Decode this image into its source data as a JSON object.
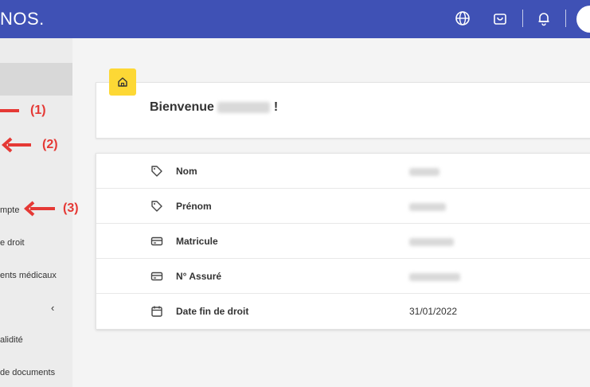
{
  "header": {
    "brand": "NOS.",
    "icons": [
      "globe-icon",
      "shopping-bag-icon",
      "bell-icon"
    ]
  },
  "sidebar": {
    "items": [
      {
        "label": "mpte"
      },
      {
        "label": "e droit"
      },
      {
        "label": "ents médicaux"
      },
      {
        "label": "alidité"
      },
      {
        "label": "de documents"
      }
    ],
    "chevron": "‹"
  },
  "annotations": [
    "(1)",
    "(2)",
    "(3)"
  ],
  "welcome": {
    "prefix": "Bienvenue",
    "suffix": "!"
  },
  "details": [
    {
      "icon": "tag-icon",
      "label": "Nom",
      "value": ""
    },
    {
      "icon": "tag-icon",
      "label": "Prénom",
      "value": ""
    },
    {
      "icon": "id-card-icon",
      "label": "Matricule",
      "value": ""
    },
    {
      "icon": "id-card-icon",
      "label": "N° Assuré",
      "value": ""
    },
    {
      "icon": "calendar-icon",
      "label": "Date fin de droit",
      "value": "31/01/2022"
    }
  ],
  "colors": {
    "header": "#3f51b5",
    "badge": "#fdd835",
    "annotation": "#e53935"
  }
}
